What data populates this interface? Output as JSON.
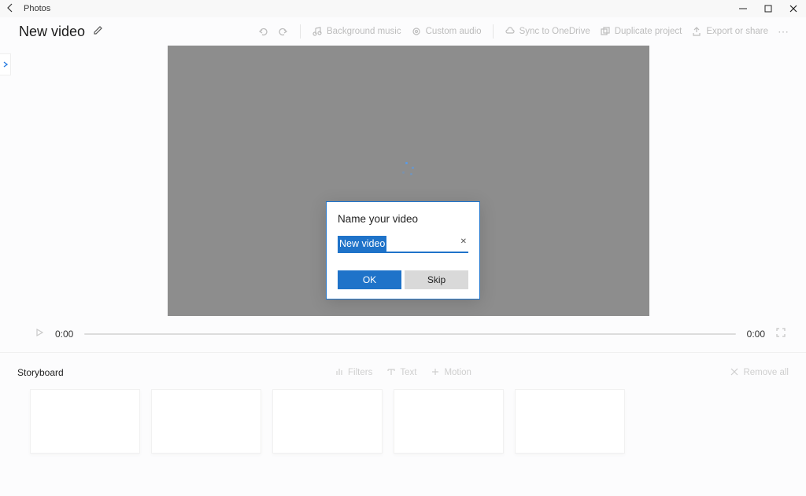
{
  "titlebar": {
    "app_name": "Photos"
  },
  "header": {
    "title": "New video",
    "buttons": {
      "bg_music": "Background music",
      "custom_audio": "Custom audio",
      "sync": "Sync to OneDrive",
      "duplicate": "Duplicate project",
      "export": "Export or share"
    }
  },
  "timeline": {
    "current": "0:00",
    "total": "0:00"
  },
  "storyboard": {
    "title": "Storyboard",
    "filters": "Filters",
    "text": "Text",
    "motion": "Motion",
    "remove_all": "Remove all"
  },
  "dialog": {
    "title": "Name your video",
    "value": "New video",
    "ok": "OK",
    "skip": "Skip"
  }
}
